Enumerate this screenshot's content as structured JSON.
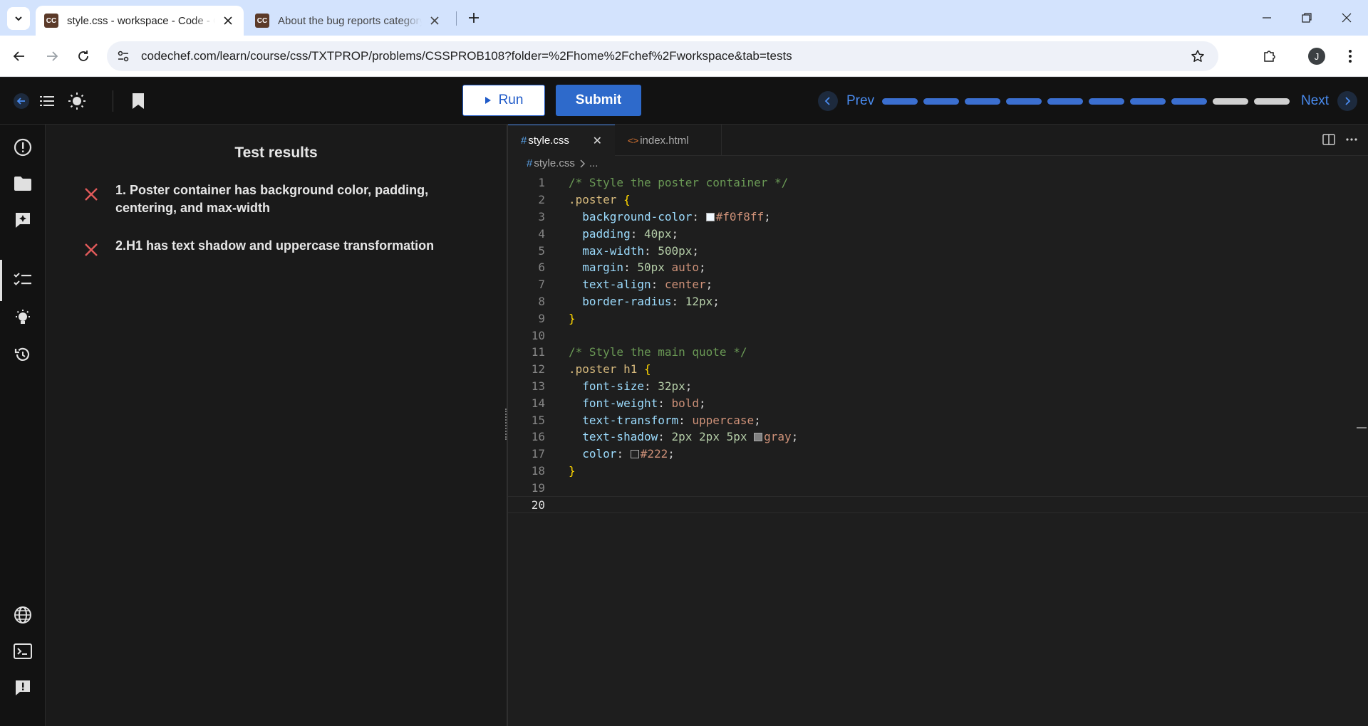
{
  "browser": {
    "tabs": [
      {
        "title": "style.css - workspace - Code - CodeChef",
        "favicon": "CC",
        "active": true
      },
      {
        "title": "About the bug reports category - CodeChef",
        "favicon": "CC",
        "active": false
      }
    ],
    "url": "codechef.com/learn/course/css/TXTPROP/problems/CSSPROB108?folder=%2Fhome%2Fchef%2Fworkspace&tab=tests",
    "profile_initial": "J"
  },
  "header": {
    "run_label": "Run",
    "submit_label": "Submit",
    "prev_label": "Prev",
    "next_label": "Next",
    "progress": {
      "total": 10,
      "completed": 8
    }
  },
  "results": {
    "title": "Test results",
    "tests": [
      {
        "label": "1. Poster container has background color, padding, centering, and max-width",
        "status": "failed"
      },
      {
        "label": "2.H1 has text shadow and uppercase transformation",
        "status": "failed"
      }
    ]
  },
  "editor": {
    "tabs": [
      {
        "label": "style.css",
        "active": true
      },
      {
        "label": "index.html",
        "active": false
      }
    ],
    "breadcrumb": {
      "file": "style.css",
      "rest": "..."
    },
    "current_line": 20,
    "lines": [
      "/* Style the poster container */",
      ".poster {",
      "  background-color: #f0f8ff;",
      "  padding: 40px;",
      "  max-width: 500px;",
      "  margin: 50px auto;",
      "  text-align: center;",
      "  border-radius: 12px;",
      "}",
      "",
      "/* Style the main quote */",
      ".poster h1 {",
      "  font-size: 32px;",
      "  font-weight: bold;",
      "  text-transform: uppercase;",
      "  text-shadow: 2px 2px 5px gray;",
      "  color: #222;",
      "}",
      "",
      ""
    ],
    "swatch_colors": {
      "3": "#f0f8ff",
      "16": "#808080",
      "17": "#222222"
    }
  },
  "colors": {
    "accent": "#2e6acb",
    "fail": "#e05a5a",
    "progress_done": "#3b6fd0",
    "progress_todo": "#d0d0d0"
  }
}
